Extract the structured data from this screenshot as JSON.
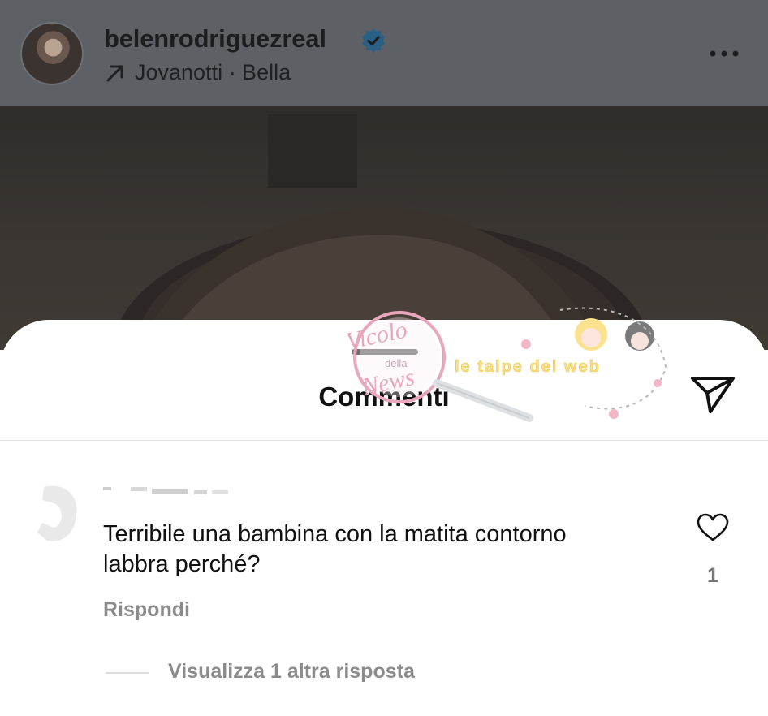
{
  "post": {
    "username": "belenrodriguezreal",
    "audio_label": "Jovanotti · Bella",
    "icons": [
      "verified-badge-icon",
      "arrow-up-right-icon",
      "more-options-icon"
    ]
  },
  "comments_sheet": {
    "title": "Commenti",
    "icons": [
      "share-icon"
    ],
    "comment": {
      "text": "Terribile una bambina con la matita contorno labbra perché?",
      "reply_label": "Rispondi",
      "like_count": "1",
      "view_replies_label": "Visualizza 1 altra risposta"
    }
  },
  "watermark": {
    "left_text": "Vicolo della News",
    "right_text": "le talpe del web"
  },
  "colors": {
    "verified_blue": "#3897f0",
    "overlay_gray": "#5d6166",
    "muted_text": "#8b8b8b"
  }
}
